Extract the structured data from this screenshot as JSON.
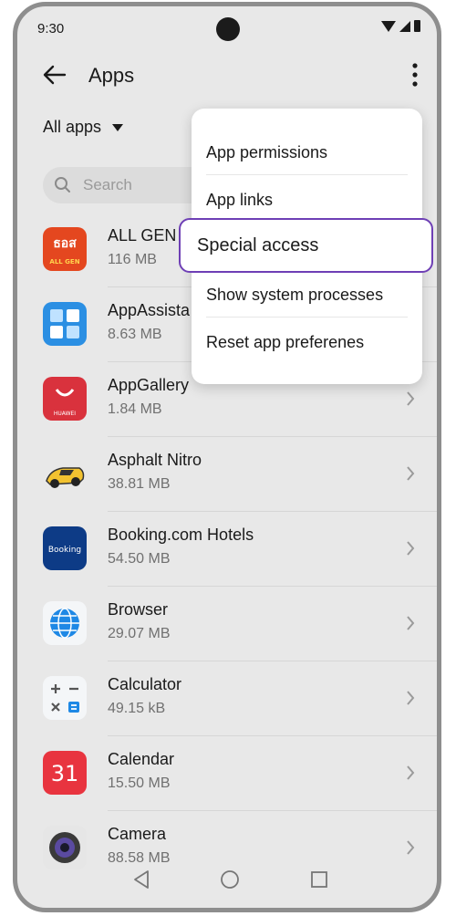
{
  "status": {
    "time": "9:30"
  },
  "header": {
    "title": "Apps"
  },
  "filter": {
    "label": "All apps"
  },
  "search": {
    "placeholder": "Search"
  },
  "apps": [
    {
      "name": "ALL GEN",
      "size": "116 MB",
      "icon": "allgen-bank-icon"
    },
    {
      "name": "AppAssista",
      "size": "8.63 MB",
      "icon": "puzzle-icon"
    },
    {
      "name": "AppGallery",
      "size": "1.84 MB",
      "icon": "huawei-bag-icon"
    },
    {
      "name": "Asphalt Nitro",
      "size": "38.81 MB",
      "icon": "race-car-icon"
    },
    {
      "name": "Booking.com Hotels",
      "size": "54.50 MB",
      "icon": "booking-icon"
    },
    {
      "name": "Browser",
      "size": "29.07 MB",
      "icon": "globe-icon"
    },
    {
      "name": "Calculator",
      "size": "49.15 kB",
      "icon": "calculator-icon"
    },
    {
      "name": "Calendar",
      "size": "15.50 MB",
      "icon": "calendar-icon"
    },
    {
      "name": "Camera",
      "size": "88.58 MB",
      "icon": "camera-icon"
    }
  ],
  "icon_text": {
    "allgen_top": "ธอส",
    "allgen_bottom": "ALL GEN",
    "appgallery": "HUAWEI",
    "booking": "Booking",
    "calendar_day": "31"
  },
  "menu": {
    "items": [
      {
        "label": "App permissions"
      },
      {
        "label": "App links"
      },
      {
        "label": "Special access"
      },
      {
        "label": "Show system processes"
      },
      {
        "label": "Reset app preferenes"
      }
    ],
    "highlight_color": "#6e3fb5"
  }
}
